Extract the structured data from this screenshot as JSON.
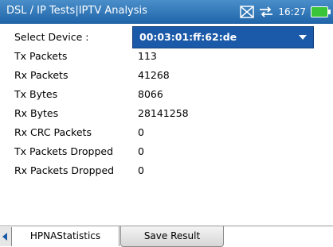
{
  "header": {
    "title": "DSL / IP Tests|IPTV Analysis",
    "time": "16:27"
  },
  "device": {
    "label": "Select Device :",
    "selected": "00:03:01:ff:62:de"
  },
  "stats": [
    {
      "label": "Tx Packets",
      "value": "113"
    },
    {
      "label": "Rx Packets",
      "value": "41268"
    },
    {
      "label": "Tx Bytes",
      "value": "8066"
    },
    {
      "label": "Rx Bytes",
      "value": "28141258"
    },
    {
      "label": "Rx CRC Packets",
      "value": "0"
    },
    {
      "label": "Tx Packets Dropped",
      "value": "0"
    },
    {
      "label": "Rx Packets Dropped",
      "value": "0"
    }
  ],
  "tabs": [
    {
      "label": "HPNAStatistics",
      "active": true
    },
    {
      "label": "Save Result",
      "active": false
    }
  ],
  "icons": {
    "status_signal": "signal-icon",
    "status_link": "usb-link-icon",
    "battery": "battery-icon",
    "tab_scroll_left": "chevron-left-icon"
  },
  "colors": {
    "header_bg": "#2a6fb5",
    "select_bg": "#1b5aa8",
    "battery_fill": "#3ac43a"
  }
}
